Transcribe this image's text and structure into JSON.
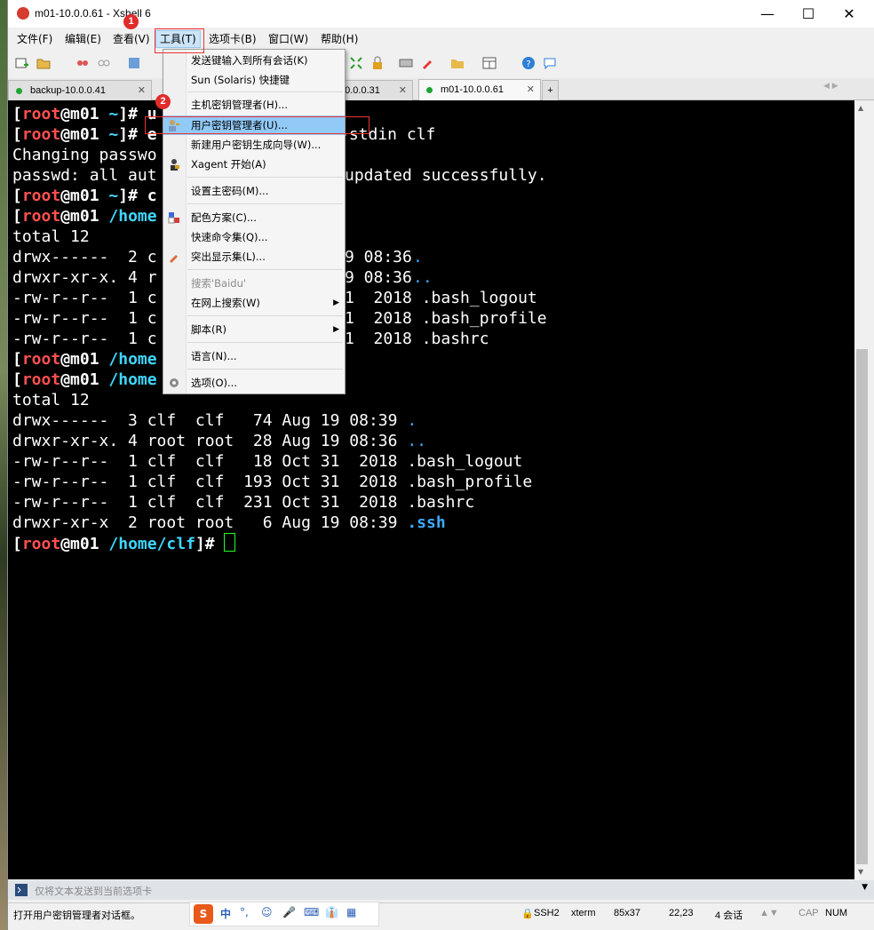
{
  "window": {
    "title": "m01-10.0.0.61 - Xshell 6"
  },
  "controls": {
    "minimize": "—",
    "maximize": "☐",
    "close": "✕"
  },
  "menubar": {
    "items": [
      {
        "id": "file",
        "label": "文件(F)"
      },
      {
        "id": "edit",
        "label": "编辑(E)"
      },
      {
        "id": "view",
        "label": "查看(V)"
      },
      {
        "id": "tools",
        "label": "工具(T)"
      },
      {
        "id": "tabs",
        "label": "选项卡(B)"
      },
      {
        "id": "window",
        "label": "窗口(W)"
      },
      {
        "id": "help",
        "label": "帮助(H)"
      }
    ]
  },
  "tabs": [
    {
      "label": "backup-10.0.0.41",
      "close": "✕"
    },
    {
      "label": "10.0.0.31",
      "close": "✕"
    },
    {
      "label": "m01-10.0.0.61",
      "close": "✕",
      "active": true
    }
  ],
  "tab_add": "+",
  "tab_nav": "◀ ▶",
  "dropdown": {
    "items": [
      {
        "label": "发送键输入到所有会话(K)"
      },
      {
        "label": "Sun (Solaris) 快捷键"
      },
      {
        "label": "主机密钥管理者(H)..."
      },
      {
        "label": "用户密钥管理者(U)..."
      },
      {
        "label": "新建用户密钥生成向导(W)..."
      },
      {
        "label": "Xagent 开始(A)"
      },
      {
        "label": "设置主密码(M)..."
      },
      {
        "label": "配色方案(C)..."
      },
      {
        "label": "快速命令集(Q)..."
      },
      {
        "label": "突出显示集(L)..."
      },
      {
        "label": "搜索'Baidu'"
      },
      {
        "label": "在网上搜索(W)"
      },
      {
        "label": "脚本(R)"
      },
      {
        "label": "语言(N)..."
      },
      {
        "label": "选项(O)..."
      }
    ],
    "submenu_arrow": "▶"
  },
  "badges": {
    "one": "1",
    "two": "2"
  },
  "terminal": {
    "lines": {
      "l1_user": "root",
      "l1_host": "m01",
      "l1_dir": "~",
      "l1_cmd": "# u",
      "l2_user": "root",
      "l2_host": "m01",
      "l2_dir": "~",
      "l2_cmd": "# e",
      "l2_tail": "-stdin clf",
      "l3": "Changing passwo",
      "l4a": "passwd: all aut",
      "l4b": "updated successfully.",
      "l5_user": "root",
      "l5_host": "m01",
      "l5_dir": "~",
      "l5_cmd": "# c",
      "l6_user": "root",
      "l6_host": "m01",
      "l6_dir": "/home",
      "l7": "total 12",
      "l8a": "drwx------  2 c",
      "l8b": "9 08:36 ",
      "l8c": ".",
      "l9a": "drwxr-xr-x. 4 r",
      "l9b": "9 08:36 ",
      "l9c": "..",
      "l10a": "-rw-r--r--  1 c",
      "l10b": "1  2018 .bash_logout",
      "l11a": "-rw-r--r--  1 c",
      "l11b": "1  2018 .bash_profile",
      "l12a": "-rw-r--r--  1 c",
      "l12b": "1  2018 .bashrc",
      "l13_user": "root",
      "l13_host": "m01",
      "l13_dir": "/home",
      "l14_user": "root",
      "l14_host": "m01",
      "l14_dir": "/home",
      "l15": "total 12",
      "l16a": "drwx------  3 clf  clf   74 Aug 19 08:39 ",
      "l16b": ".",
      "l17a": "drwxr-xr-x. 4 root root  28 Aug 19 08:36 ",
      "l17b": "..",
      "l18": "-rw-r--r--  1 clf  clf   18 Oct 31  2018 .bash_logout",
      "l19": "-rw-r--r--  1 clf  clf  193 Oct 31  2018 .bash_profile",
      "l20": "-rw-r--r--  1 clf  clf  231 Oct 31  2018 .bashrc",
      "l21a": "drwxr-xr-x  2 root root   6 Aug 19 08:39 ",
      "l21b": ".ssh",
      "l22_user": "root",
      "l22_host": "m01",
      "l22_dir": "/home/clf",
      "l22_hash": "# "
    }
  },
  "inputbar": {
    "placeholder": "仅将文本发送到当前选项卡"
  },
  "statusbar": {
    "message": "打开用户密钥管理者对话框。",
    "protocol": "SSH2",
    "term": "xterm",
    "size": "85x37",
    "pos": "22,23",
    "sessions": "4 会话",
    "cap": "CAP",
    "num": "NUM"
  },
  "ime": {
    "items": [
      "S",
      "中",
      "°,",
      "☺",
      "🎤",
      "⌨",
      "👔",
      "▦"
    ]
  },
  "colors": {
    "prompt_user": "#ff5050",
    "prompt_path": "#3fd7ff",
    "dir": "#3fa9ff",
    "cursor": "#22ff22"
  }
}
